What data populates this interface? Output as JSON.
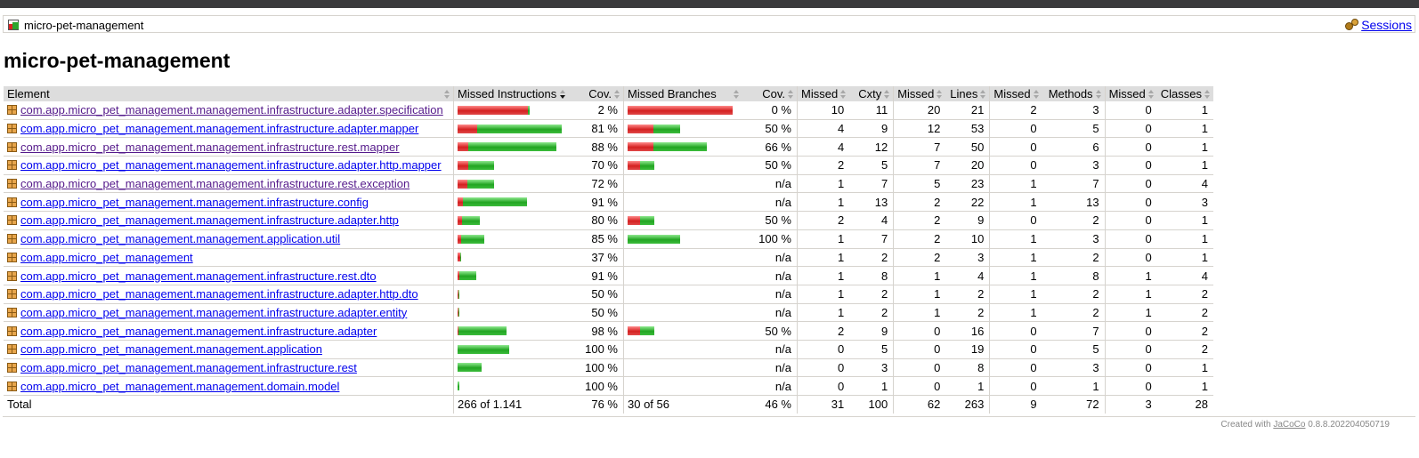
{
  "breadcrumb": {
    "title": "micro-pet-management",
    "sessions_label": "Sessions",
    "icon": "report-icon",
    "sessions_icon": "sessions-icon"
  },
  "page_title": "micro-pet-management",
  "colors": {
    "missed": "#d42020",
    "covered": "#22a522",
    "header_bg": "#dddddd"
  },
  "table": {
    "headers": [
      "Element",
      "Missed Instructions",
      "Cov.",
      "Missed Branches",
      "Cov.",
      "Missed",
      "Cxty",
      "Missed",
      "Lines",
      "Missed",
      "Methods",
      "Missed",
      "Classes"
    ],
    "rows": [
      {
        "name": "com.app.micro_pet_management.management.infrastructure.adapter.specification",
        "visited": true,
        "instr_cov": "2 %",
        "branch_cov": "0 %",
        "instr_bar": {
          "missed": 79,
          "covered": 2
        },
        "branch_bar": {
          "missed": 118,
          "covered": 0
        },
        "missed_cxty": "10",
        "cxty": "11",
        "missed_lines": "20",
        "lines": "21",
        "missed_methods": "2",
        "methods": "3",
        "missed_classes": "0",
        "classes": "1"
      },
      {
        "name": "com.app.micro_pet_management.management.infrastructure.adapter.mapper",
        "visited": false,
        "instr_cov": "81 %",
        "branch_cov": "50 %",
        "instr_bar": {
          "missed": 22,
          "covered": 95
        },
        "branch_bar": {
          "missed": 29,
          "covered": 30
        },
        "missed_cxty": "4",
        "cxty": "9",
        "missed_lines": "12",
        "lines": "53",
        "missed_methods": "0",
        "methods": "5",
        "missed_classes": "0",
        "classes": "1"
      },
      {
        "name": "com.app.micro_pet_management.management.infrastructure.rest.mapper",
        "visited": true,
        "instr_cov": "88 %",
        "branch_cov": "66 %",
        "instr_bar": {
          "missed": 12,
          "covered": 99
        },
        "branch_bar": {
          "missed": 29,
          "covered": 60
        },
        "missed_cxty": "4",
        "cxty": "12",
        "missed_lines": "7",
        "lines": "50",
        "missed_methods": "0",
        "methods": "6",
        "missed_classes": "0",
        "classes": "1"
      },
      {
        "name": "com.app.micro_pet_management.management.infrastructure.adapter.http.mapper",
        "visited": false,
        "instr_cov": "70 %",
        "branch_cov": "50 %",
        "instr_bar": {
          "missed": 12,
          "covered": 29
        },
        "branch_bar": {
          "missed": 14,
          "covered": 16
        },
        "missed_cxty": "2",
        "cxty": "5",
        "missed_lines": "7",
        "lines": "20",
        "missed_methods": "0",
        "methods": "3",
        "missed_classes": "0",
        "classes": "1"
      },
      {
        "name": "com.app.micro_pet_management.management.infrastructure.rest.exception",
        "visited": true,
        "instr_cov": "72 %",
        "branch_cov": "n/a",
        "instr_bar": {
          "missed": 11,
          "covered": 30
        },
        "branch_bar": null,
        "missed_cxty": "1",
        "cxty": "7",
        "missed_lines": "5",
        "lines": "23",
        "missed_methods": "1",
        "methods": "7",
        "missed_classes": "0",
        "classes": "4"
      },
      {
        "name": "com.app.micro_pet_management.management.infrastructure.config",
        "visited": false,
        "instr_cov": "91 %",
        "branch_cov": "n/a",
        "instr_bar": {
          "missed": 6,
          "covered": 72
        },
        "branch_bar": null,
        "missed_cxty": "1",
        "cxty": "13",
        "missed_lines": "2",
        "lines": "22",
        "missed_methods": "1",
        "methods": "13",
        "missed_classes": "0",
        "classes": "3"
      },
      {
        "name": "com.app.micro_pet_management.management.infrastructure.adapter.http",
        "visited": false,
        "instr_cov": "80 %",
        "branch_cov": "50 %",
        "instr_bar": {
          "missed": 5,
          "covered": 20
        },
        "branch_bar": {
          "missed": 14,
          "covered": 16
        },
        "missed_cxty": "2",
        "cxty": "4",
        "missed_lines": "2",
        "lines": "9",
        "missed_methods": "0",
        "methods": "2",
        "missed_classes": "0",
        "classes": "1"
      },
      {
        "name": "com.app.micro_pet_management.management.application.util",
        "visited": false,
        "instr_cov": "85 %",
        "branch_cov": "100 %",
        "instr_bar": {
          "missed": 4,
          "covered": 26
        },
        "branch_bar": {
          "missed": 0,
          "covered": 59
        },
        "missed_cxty": "1",
        "cxty": "7",
        "missed_lines": "2",
        "lines": "10",
        "missed_methods": "1",
        "methods": "3",
        "missed_classes": "0",
        "classes": "1"
      },
      {
        "name": "com.app.micro_pet_management",
        "visited": false,
        "instr_cov": "37 %",
        "branch_cov": "n/a",
        "instr_bar": {
          "missed": 3,
          "covered": 1
        },
        "branch_bar": null,
        "missed_cxty": "1",
        "cxty": "2",
        "missed_lines": "2",
        "lines": "3",
        "missed_methods": "1",
        "methods": "2",
        "missed_classes": "0",
        "classes": "1"
      },
      {
        "name": "com.app.micro_pet_management.management.infrastructure.rest.dto",
        "visited": false,
        "instr_cov": "91 %",
        "branch_cov": "n/a",
        "instr_bar": {
          "missed": 2,
          "covered": 19
        },
        "branch_bar": null,
        "missed_cxty": "1",
        "cxty": "8",
        "missed_lines": "1",
        "lines": "4",
        "missed_methods": "1",
        "methods": "8",
        "missed_classes": "1",
        "classes": "4"
      },
      {
        "name": "com.app.micro_pet_management.management.infrastructure.adapter.http.dto",
        "visited": false,
        "instr_cov": "50 %",
        "branch_cov": "n/a",
        "instr_bar": {
          "missed": 1,
          "covered": 1
        },
        "branch_bar": null,
        "missed_cxty": "1",
        "cxty": "2",
        "missed_lines": "1",
        "lines": "2",
        "missed_methods": "1",
        "methods": "2",
        "missed_classes": "1",
        "classes": "2"
      },
      {
        "name": "com.app.micro_pet_management.management.infrastructure.adapter.entity",
        "visited": false,
        "instr_cov": "50 %",
        "branch_cov": "n/a",
        "instr_bar": {
          "missed": 1,
          "covered": 1
        },
        "branch_bar": null,
        "missed_cxty": "1",
        "cxty": "2",
        "missed_lines": "1",
        "lines": "2",
        "missed_methods": "1",
        "methods": "2",
        "missed_classes": "1",
        "classes": "2"
      },
      {
        "name": "com.app.micro_pet_management.management.infrastructure.adapter",
        "visited": false,
        "instr_cov": "98 %",
        "branch_cov": "50 %",
        "instr_bar": {
          "missed": 1,
          "covered": 54
        },
        "branch_bar": {
          "missed": 14,
          "covered": 16
        },
        "missed_cxty": "2",
        "cxty": "9",
        "missed_lines": "0",
        "lines": "16",
        "missed_methods": "0",
        "methods": "7",
        "missed_classes": "0",
        "classes": "2"
      },
      {
        "name": "com.app.micro_pet_management.management.application",
        "visited": false,
        "instr_cov": "100 %",
        "branch_cov": "n/a",
        "instr_bar": {
          "missed": 0,
          "covered": 58
        },
        "branch_bar": null,
        "missed_cxty": "0",
        "cxty": "5",
        "missed_lines": "0",
        "lines": "19",
        "missed_methods": "0",
        "methods": "5",
        "missed_classes": "0",
        "classes": "2"
      },
      {
        "name": "com.app.micro_pet_management.management.infrastructure.rest",
        "visited": false,
        "instr_cov": "100 %",
        "branch_cov": "n/a",
        "instr_bar": {
          "missed": 0,
          "covered": 27
        },
        "branch_bar": null,
        "missed_cxty": "0",
        "cxty": "3",
        "missed_lines": "0",
        "lines": "8",
        "missed_methods": "0",
        "methods": "3",
        "missed_classes": "0",
        "classes": "1"
      },
      {
        "name": "com.app.micro_pet_management.management.domain.model",
        "visited": false,
        "instr_cov": "100 %",
        "branch_cov": "n/a",
        "instr_bar": {
          "missed": 0,
          "covered": 2
        },
        "branch_bar": null,
        "missed_cxty": "0",
        "cxty": "1",
        "missed_lines": "0",
        "lines": "1",
        "missed_methods": "0",
        "methods": "1",
        "missed_classes": "0",
        "classes": "1"
      }
    ],
    "total": {
      "label": "Total",
      "instr": "266 of 1.141",
      "instr_cov": "76 %",
      "branch": "30 of 56",
      "branch_cov": "46 %",
      "missed_cxty": "31",
      "cxty": "100",
      "missed_lines": "62",
      "lines": "263",
      "missed_methods": "9",
      "methods": "72",
      "missed_classes": "3",
      "classes": "28"
    }
  },
  "footer": {
    "prefix": "Created with",
    "link": "JaCoCo",
    "version": "0.8.8.202204050719"
  }
}
